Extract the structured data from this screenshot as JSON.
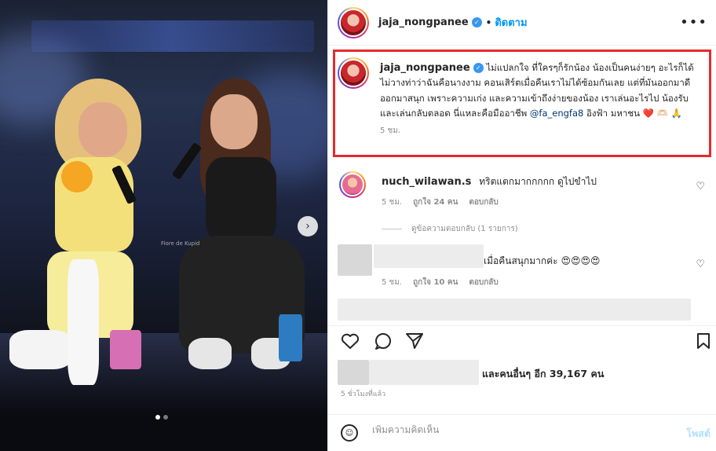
{
  "post": {
    "username": "jaja_nongpanee",
    "verified_icon": "verified-badge-icon",
    "separator": "•",
    "follow_label": "ติดตาม",
    "more_icon": "more-options-icon"
  },
  "photo": {
    "watermark": "Fiore de Kupid",
    "carousel_next": "›"
  },
  "caption": {
    "username": "jaja_nongpanee",
    "text_1": "ไม่แปลกใจ ที่ใครๆก็รักน้อง น้องเป็นคนง่ายๆ อะไรก็ได้ ไม่วางท่าว่าฉันคือนางงาม คอนเสิร์ตเมื่อคืนเราไม่ได้ซ้อมกันเลย แต่ที่มันออกมาดี ออกมาสนุก เพราะความเก่ง และความเข้าถึงง่ายของน้อง เราเล่นอะไรไป น้องรับและเล่นกลับตลอด นี่แหละคือมืออาชีพ",
    "mention": "@fa_engfa8",
    "text_2": "อิงฟ้า มหาชน",
    "emoji_heart": "❤️",
    "emoji_rest": "🫶🏻 🙏",
    "time": "5 ชม."
  },
  "comments": [
    {
      "username": "nuch_wilawan.s",
      "text": "ทริตแตกมากกกกก ดูไปขำไป",
      "time": "5 ชม.",
      "likes": "ถูกใจ 24 คน",
      "reply": "ตอบกลับ"
    },
    {
      "username": "",
      "text": "เมื่อคืนสนุกมากค่ะ 😍😍😍😍",
      "time": "5 ชม.",
      "likes": "ถูกใจ 10 คน",
      "reply": "ตอบกลับ"
    }
  ],
  "view_replies": "ดูข้อความตอบกลับ (1 รายการ)",
  "actions": {
    "like_icon": "heart-icon",
    "comment_icon": "comment-icon",
    "share_icon": "share-icon",
    "save_icon": "bookmark-icon"
  },
  "likes_text": "และคนอื่นๆ อีก 39,167 คน",
  "posted_ago": "5 ชั่วโมงที่แล้ว",
  "add_comment": {
    "placeholder": "เพิ่มความคิดเห็น",
    "post_label": "โพสต์",
    "emoji_icon": "emoji-icon"
  },
  "colors": {
    "accent": "#0095f6",
    "highlight_box": "#e32b2b",
    "mention": "#00376b",
    "muted": "#8e8e8e"
  }
}
